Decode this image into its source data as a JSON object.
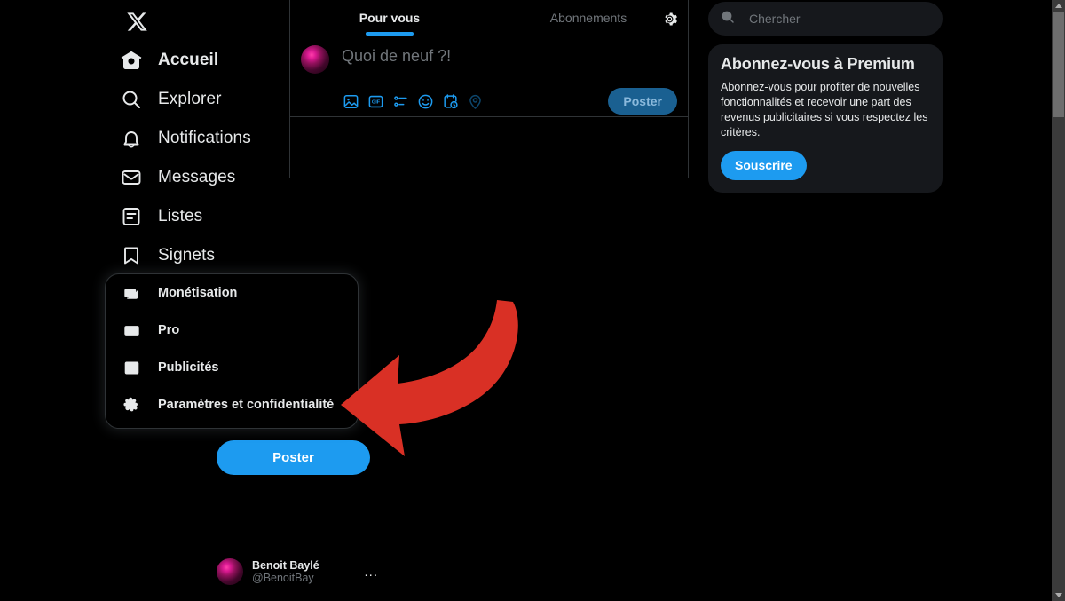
{
  "app": {
    "name": "X",
    "logo_icon": "x-logo-icon"
  },
  "sidebar": {
    "items": [
      {
        "label": "Accueil",
        "icon": "home-icon",
        "active": true
      },
      {
        "label": "Explorer",
        "icon": "search-icon",
        "active": false
      },
      {
        "label": "Notifications",
        "icon": "bell-icon",
        "active": false
      },
      {
        "label": "Messages",
        "icon": "envelope-icon",
        "active": false
      },
      {
        "label": "Listes",
        "icon": "list-icon",
        "active": false
      },
      {
        "label": "Signets",
        "icon": "bookmark-icon",
        "active": false
      }
    ],
    "post_button": "Poster",
    "account": {
      "display_name": "Benoit Baylé",
      "handle": "@BenoitBay",
      "more_icon": "ellipsis-icon",
      "more_label": "..."
    }
  },
  "menu": {
    "items": [
      {
        "label": "Monétisation",
        "icon": "money-icon"
      },
      {
        "label": "Pro",
        "icon": "columns-icon"
      },
      {
        "label": "Publicités",
        "icon": "external-link-icon"
      },
      {
        "label": "Paramètres et confidentialité",
        "icon": "gear-icon"
      }
    ]
  },
  "timeline": {
    "tabs": [
      {
        "label": "Pour vous",
        "active": true
      },
      {
        "label": "Abonnements",
        "active": false
      }
    ],
    "settings_icon": "gear-icon",
    "composer": {
      "placeholder": "Quoi de neuf ?!",
      "post_label": "Poster",
      "tools": [
        {
          "icon": "image-icon",
          "dimmed": false
        },
        {
          "icon": "gif-icon",
          "dimmed": false
        },
        {
          "icon": "poll-icon",
          "dimmed": false
        },
        {
          "icon": "emoji-icon",
          "dimmed": false
        },
        {
          "icon": "schedule-icon",
          "dimmed": false
        },
        {
          "icon": "location-icon",
          "dimmed": true
        }
      ]
    }
  },
  "right": {
    "search": {
      "placeholder": "Chercher",
      "value": "",
      "icon": "search-icon"
    },
    "premium": {
      "title": "Abonnez-vous à Premium",
      "body": "Abonnez-vous pour profiter de nouvelles fonctionnalités et recevoir une part des revenus publicitaires si vous respectez les critères.",
      "button": "Souscrire"
    }
  },
  "annotation": {
    "shape": "curved-arrow-left",
    "color": "#d93025"
  },
  "colors": {
    "background": "#000000",
    "accent_blue": "#1d9bf0",
    "panel": "#16181c",
    "border": "#2f3336",
    "muted_text": "#71767b",
    "text": "#e7e9ea",
    "arrow_red": "#d93025"
  },
  "scrollbar": {
    "orientation": "vertical",
    "position_percent": 2
  }
}
